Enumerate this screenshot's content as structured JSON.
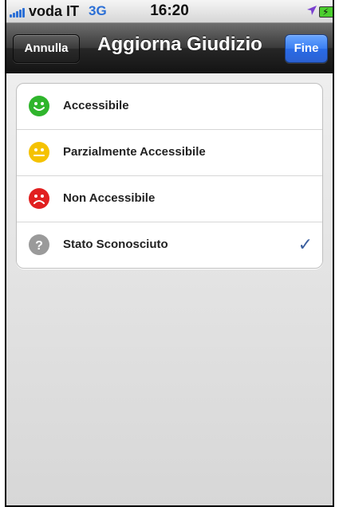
{
  "status": {
    "carrier": "voda IT",
    "network": "3G",
    "time": "16:20"
  },
  "nav": {
    "cancel_label": "Annulla",
    "title": "Aggiorna Giudizio",
    "done_label": "Fine"
  },
  "options": [
    {
      "label": "Accessibile",
      "icon": "happy-face-icon",
      "color": "#2fb52c",
      "selected": false
    },
    {
      "label": "Parzialmente Accessibile",
      "icon": "neutral-face-icon",
      "color": "#f5c200",
      "selected": false
    },
    {
      "label": "Non Accessibile",
      "icon": "sad-face-icon",
      "color": "#e12020",
      "selected": false
    },
    {
      "label": "Stato Sconosciuto",
      "icon": "question-mark-icon",
      "color": "#9a9a9a",
      "selected": true
    }
  ],
  "colors": {
    "accent": "#2b6fd6",
    "checkmark": "#3b5f9f"
  }
}
